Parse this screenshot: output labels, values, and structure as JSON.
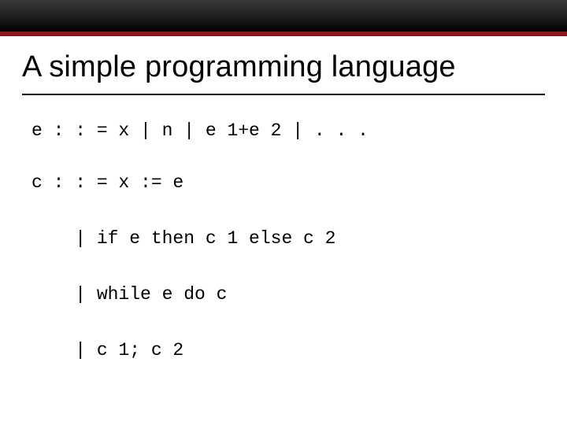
{
  "title": "A simple programming language",
  "grammar": {
    "e_rule": "e : : = x | n | e 1+e 2 | . . .",
    "c_rule_1": "c : : = x := e",
    "c_rule_2": "    | if e then c 1 else c 2",
    "c_rule_3": "    | while e do c",
    "c_rule_4": "    | c 1; c 2"
  }
}
